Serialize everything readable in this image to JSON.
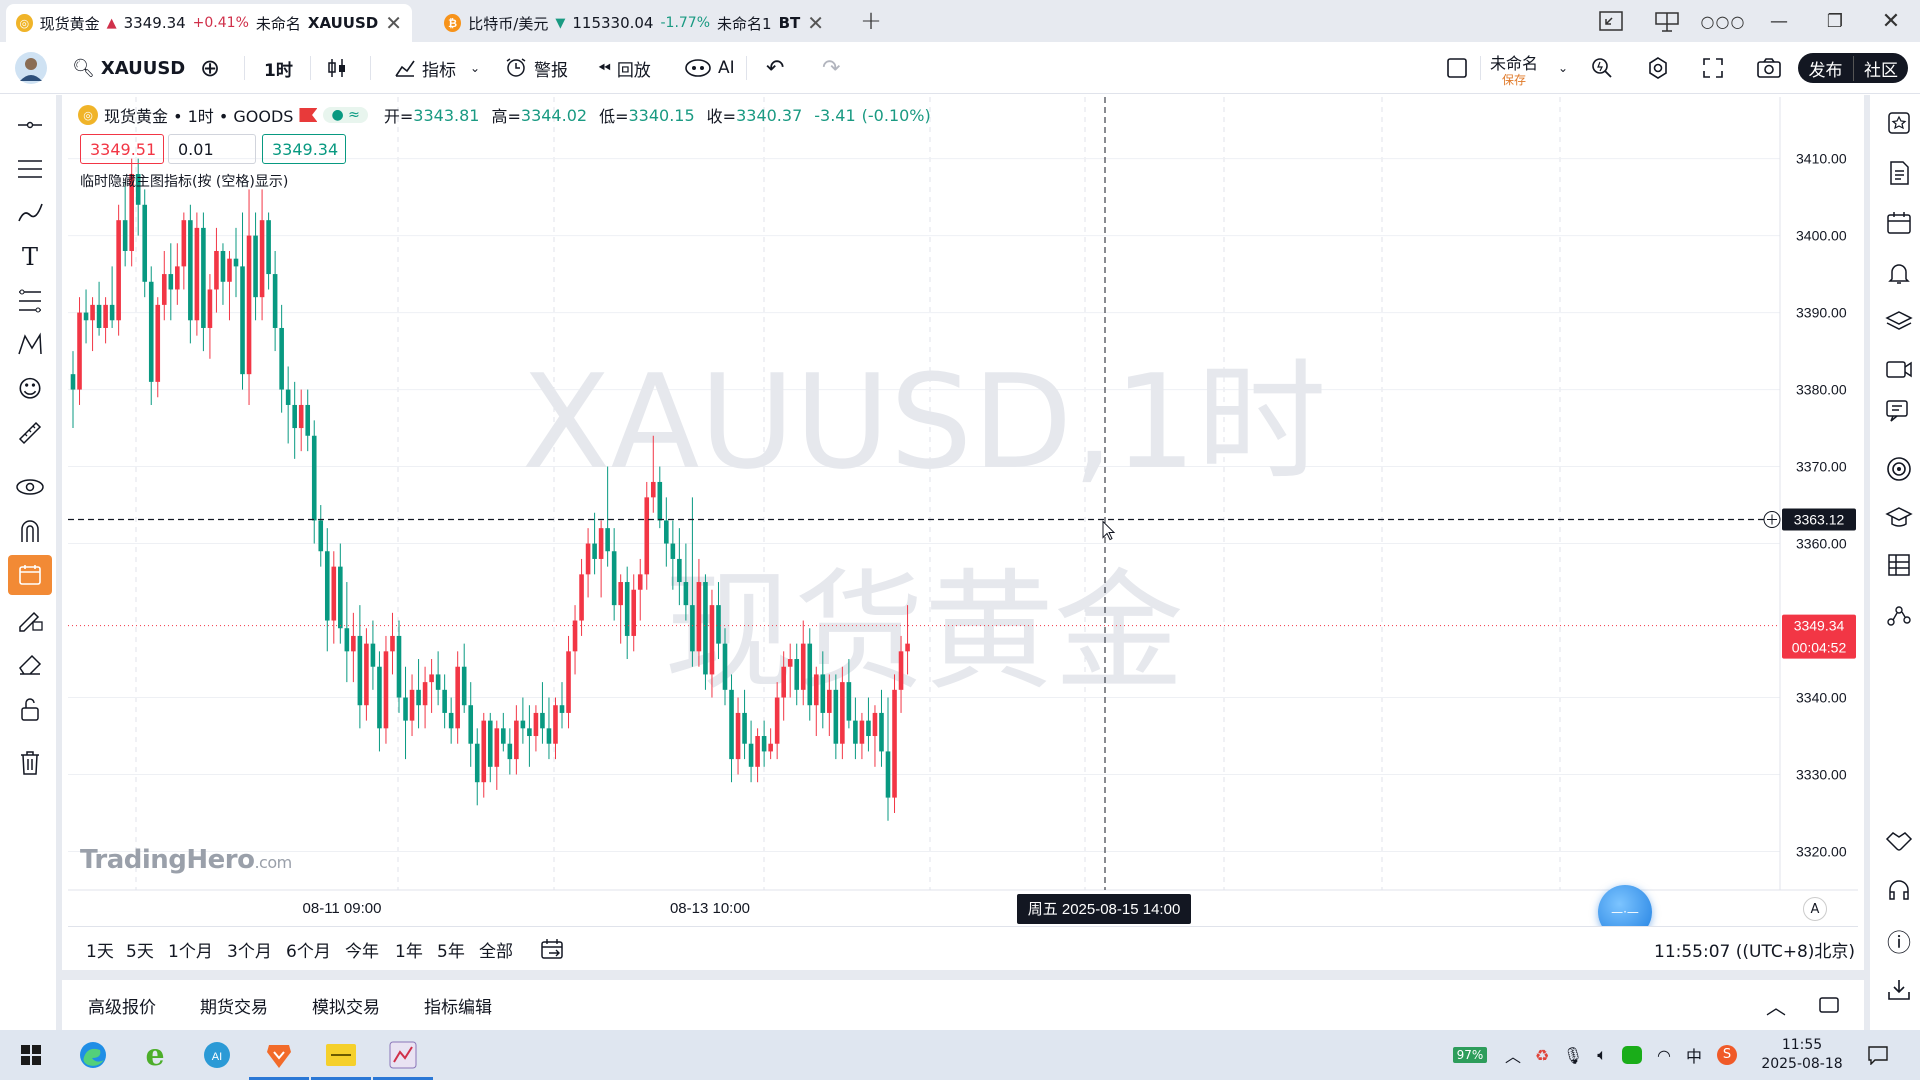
{
  "tabs": [
    {
      "name": "现货黄金",
      "arrow": "▲",
      "price": "3349.34",
      "change": "+0.41%",
      "layout": "未命名",
      "symbol": "XAUUSD",
      "active": true
    },
    {
      "name": "比特币/美元",
      "arrow": "▼",
      "price": "115330.04",
      "change": "-1.77%",
      "layout": "未命名1",
      "symbol": "BT",
      "active": false
    }
  ],
  "toolbar": {
    "symbol": "XAUUSD",
    "interval": "1时",
    "indicators": "指标",
    "alerts": "警报",
    "replay": "回放",
    "ai": "AI",
    "layout_name": "未命名",
    "save": "保存",
    "publish": "发布",
    "community": "社区"
  },
  "legend": {
    "symbol_title": "现货黄金 • 1时 • GOODS",
    "open_label": "开=",
    "open": "3343.81",
    "high_label": "高=",
    "high": "3344.02",
    "low_label": "低=",
    "low": "3340.15",
    "close_label": "收=",
    "close": "3340.37",
    "change": "-3.41",
    "change_pct": "(-0.10%)",
    "sell": "3349.51",
    "qty": "0.01",
    "buy": "3349.34",
    "hint": "临时隐藏主图指标(按 (空格)显示)"
  },
  "watermark": {
    "line1": "XAUUSD,1时",
    "line2": "现货黄金"
  },
  "brand": {
    "name": "TradingHero",
    "suffix": ".com"
  },
  "chart_data": {
    "type": "candlestick",
    "x_axis_type": "time",
    "x_ticks": [
      "08-11 09:00",
      "08-13 10:00"
    ],
    "crosshair_time": "周五 2025-08-15  14:00",
    "crosshair_price": "3363.12",
    "last_price": "3349.34",
    "countdown": "00:04:52",
    "ylim": [
      3315,
      3418
    ],
    "y_ticks": [
      "3410.00",
      "3400.00",
      "3390.00",
      "3380.00",
      "3370.00",
      "3360.00",
      "3340.00",
      "3330.00",
      "3320.00"
    ],
    "up_color": "#f23645",
    "down_color": "#089981",
    "ohlc": [
      [
        3382,
        3385,
        3375,
        3380
      ],
      [
        3380,
        3392,
        3378,
        3390
      ],
      [
        3390,
        3393,
        3386,
        3389
      ],
      [
        3389,
        3392,
        3385,
        3391
      ],
      [
        3391,
        3394,
        3387,
        3388
      ],
      [
        3388,
        3392,
        3386,
        3391
      ],
      [
        3391,
        3396,
        3388,
        3389
      ],
      [
        3389,
        3404,
        3387,
        3402
      ],
      [
        3402,
        3407,
        3396,
        3398
      ],
      [
        3398,
        3410,
        3396,
        3408
      ],
      [
        3408,
        3410,
        3400,
        3404
      ],
      [
        3404,
        3406,
        3392,
        3394
      ],
      [
        3394,
        3396,
        3378,
        3381
      ],
      [
        3381,
        3392,
        3379,
        3391
      ],
      [
        3391,
        3398,
        3389,
        3395
      ],
      [
        3395,
        3399,
        3389,
        3393
      ],
      [
        3393,
        3399,
        3391,
        3396
      ],
      [
        3396,
        3403,
        3393,
        3402
      ],
      [
        3402,
        3404,
        3386,
        3389
      ],
      [
        3389,
        3403,
        3387,
        3401
      ],
      [
        3401,
        3403,
        3385,
        3388
      ],
      [
        3388,
        3395,
        3384,
        3393
      ],
      [
        3393,
        3401,
        3390,
        3398
      ],
      [
        3398,
        3399,
        3391,
        3394
      ],
      [
        3394,
        3398,
        3389,
        3397
      ],
      [
        3397,
        3401,
        3392,
        3396
      ],
      [
        3396,
        3403,
        3380,
        3382
      ],
      [
        3382,
        3406,
        3378,
        3400
      ],
      [
        3400,
        3403,
        3389,
        3392
      ],
      [
        3392,
        3406,
        3389,
        3402
      ],
      [
        3402,
        3403,
        3393,
        3395
      ],
      [
        3395,
        3398,
        3385,
        3388
      ],
      [
        3388,
        3391,
        3377,
        3380
      ],
      [
        3380,
        3383,
        3373,
        3378
      ],
      [
        3378,
        3381,
        3371,
        3375
      ],
      [
        3375,
        3380,
        3372,
        3378
      ],
      [
        3378,
        3380,
        3372,
        3374
      ],
      [
        3374,
        3376,
        3360,
        3363
      ],
      [
        3363,
        3365,
        3357,
        3359
      ],
      [
        3359,
        3362,
        3346,
        3350
      ],
      [
        3350,
        3359,
        3347,
        3357
      ],
      [
        3357,
        3360,
        3347,
        3349
      ],
      [
        3349,
        3355,
        3342,
        3346
      ],
      [
        3346,
        3351,
        3342,
        3348
      ],
      [
        3348,
        3352,
        3336,
        3339
      ],
      [
        3339,
        3349,
        3337,
        3347
      ],
      [
        3347,
        3350,
        3341,
        3344
      ],
      [
        3344,
        3346,
        3333,
        3336
      ],
      [
        3336,
        3348,
        3334,
        3346
      ],
      [
        3346,
        3351,
        3343,
        3348
      ],
      [
        3348,
        3350,
        3338,
        3340
      ],
      [
        3340,
        3344,
        3332,
        3337
      ],
      [
        3337,
        3343,
        3335,
        3341
      ],
      [
        3341,
        3345,
        3336,
        3339
      ],
      [
        3339,
        3344,
        3336,
        3342
      ],
      [
        3342,
        3345,
        3338,
        3343
      ],
      [
        3343,
        3346,
        3339,
        3341
      ],
      [
        3341,
        3343,
        3336,
        3338
      ],
      [
        3338,
        3340,
        3334,
        3336
      ],
      [
        3336,
        3346,
        3334,
        3344
      ],
      [
        3344,
        3347,
        3338,
        3339
      ],
      [
        3339,
        3342,
        3331,
        3334
      ],
      [
        3334,
        3336,
        3326,
        3329
      ],
      [
        3329,
        3338,
        3327,
        3337
      ],
      [
        3337,
        3338,
        3329,
        3331
      ],
      [
        3331,
        3337,
        3328,
        3336
      ],
      [
        3336,
        3338,
        3333,
        3334
      ],
      [
        3334,
        3336,
        3330,
        3332
      ],
      [
        3332,
        3339,
        3330,
        3337
      ],
      [
        3337,
        3340,
        3334,
        3336
      ],
      [
        3336,
        3339,
        3331,
        3335
      ],
      [
        3335,
        3339,
        3333,
        3338
      ],
      [
        3338,
        3342,
        3334,
        3336
      ],
      [
        3336,
        3340,
        3332,
        3334
      ],
      [
        3334,
        3340,
        3332,
        3339
      ],
      [
        3339,
        3342,
        3336,
        3338
      ],
      [
        3338,
        3348,
        3336,
        3346
      ],
      [
        3346,
        3352,
        3343,
        3350
      ],
      [
        3350,
        3358,
        3348,
        3356
      ],
      [
        3356,
        3362,
        3353,
        3360
      ],
      [
        3360,
        3364,
        3356,
        3358
      ],
      [
        3358,
        3363,
        3353,
        3362
      ],
      [
        3362,
        3370,
        3357,
        3359
      ],
      [
        3359,
        3362,
        3350,
        3352
      ],
      [
        3352,
        3356,
        3347,
        3355
      ],
      [
        3355,
        3357,
        3345,
        3348
      ],
      [
        3348,
        3356,
        3346,
        3354
      ],
      [
        3354,
        3358,
        3350,
        3356
      ],
      [
        3356,
        3368,
        3354,
        3366
      ],
      [
        3366,
        3374,
        3364,
        3368
      ],
      [
        3368,
        3370,
        3362,
        3363
      ],
      [
        3363,
        3366,
        3357,
        3360
      ],
      [
        3360,
        3363,
        3354,
        3358
      ],
      [
        3358,
        3362,
        3352,
        3355
      ],
      [
        3355,
        3360,
        3350,
        3352
      ],
      [
        3352,
        3366,
        3344,
        3346
      ],
      [
        3346,
        3358,
        3344,
        3355
      ],
      [
        3355,
        3356,
        3341,
        3343
      ],
      [
        3343,
        3354,
        3340,
        3352
      ],
      [
        3352,
        3355,
        3345,
        3347
      ],
      [
        3347,
        3349,
        3339,
        3341
      ],
      [
        3341,
        3343,
        3329,
        3332
      ],
      [
        3332,
        3340,
        3330,
        3338
      ],
      [
        3338,
        3341,
        3332,
        3334
      ],
      [
        3334,
        3337,
        3329,
        3331
      ],
      [
        3331,
        3336,
        3329,
        3335
      ],
      [
        3335,
        3337,
        3331,
        3333
      ],
      [
        3333,
        3336,
        3332,
        3334
      ],
      [
        3334,
        3342,
        3332,
        3340
      ],
      [
        3340,
        3346,
        3337,
        3344
      ],
      [
        3344,
        3347,
        3340,
        3345
      ],
      [
        3345,
        3347,
        3339,
        3341
      ],
      [
        3341,
        3350,
        3339,
        3347
      ],
      [
        3347,
        3349,
        3337,
        3339
      ],
      [
        3339,
        3344,
        3335,
        3343
      ],
      [
        3343,
        3346,
        3336,
        3338
      ],
      [
        3338,
        3343,
        3335,
        3341
      ],
      [
        3341,
        3343,
        3332,
        3334
      ],
      [
        3334,
        3344,
        3332,
        3342
      ],
      [
        3342,
        3345,
        3336,
        3337
      ],
      [
        3337,
        3340,
        3332,
        3334
      ],
      [
        3334,
        3338,
        3332,
        3337
      ],
      [
        3337,
        3340,
        3333,
        3335
      ],
      [
        3335,
        3339,
        3331,
        3338
      ],
      [
        3338,
        3341,
        3331,
        3333
      ],
      [
        3333,
        3340,
        3324,
        3327
      ],
      [
        3327,
        3343,
        3325,
        3341
      ],
      [
        3341,
        3348,
        3338,
        3346
      ],
      [
        3346,
        3352,
        3343,
        3347
      ]
    ]
  },
  "ranges": [
    "1天",
    "5天",
    "1个月",
    "3个月",
    "6个月",
    "今年",
    "1年",
    "5年",
    "全部"
  ],
  "clock": "11:55:07 ((UTC+8)北京)",
  "panel_tabs": [
    "高级报价",
    "期货交易",
    "模拟交易",
    "指标编辑"
  ],
  "taskbar": {
    "battery": "97%",
    "time": "11:55",
    "date": "2025-08-18",
    "ime": "中"
  }
}
